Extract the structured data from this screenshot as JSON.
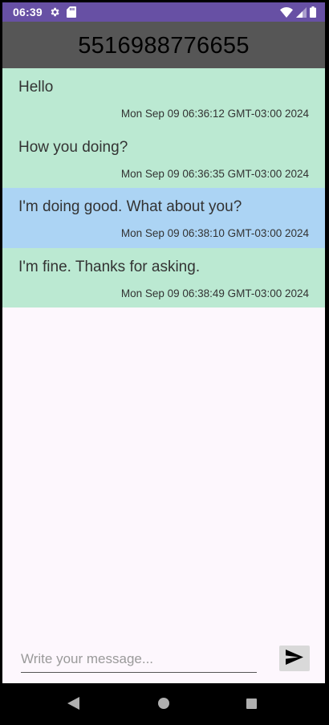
{
  "status_bar": {
    "time": "06:39",
    "icons": [
      "gear-icon",
      "sd-card-icon",
      "wifi-icon",
      "signal-icon",
      "battery-icon"
    ]
  },
  "app_bar": {
    "title": "5516988776655",
    "background": "#565656"
  },
  "messages": [
    {
      "text": "Hello",
      "timestamp": "Mon Sep 09 06:36:12 GMT-03:00 2024",
      "direction": "received",
      "color": "#bbe9d2"
    },
    {
      "text": "How you doing?",
      "timestamp": "Mon Sep 09 06:36:35 GMT-03:00 2024",
      "direction": "received",
      "color": "#bbe9d2"
    },
    {
      "text": "I'm doing good. What about you?",
      "timestamp": "Mon Sep 09 06:38:10 GMT-03:00 2024",
      "direction": "sent",
      "color": "#acd4f4"
    },
    {
      "text": "I'm fine. Thanks for asking.",
      "timestamp": "Mon Sep 09 06:38:49 GMT-03:00 2024",
      "direction": "received",
      "color": "#bbe9d2"
    }
  ],
  "composer": {
    "placeholder": "Write your message...",
    "value": "",
    "send_icon": "send-icon"
  },
  "nav_bar": {
    "icons": [
      "back-icon",
      "home-icon",
      "recents-icon"
    ]
  },
  "colors": {
    "status_bar": "#6750a4",
    "screen_background": "#fdf7fd"
  }
}
